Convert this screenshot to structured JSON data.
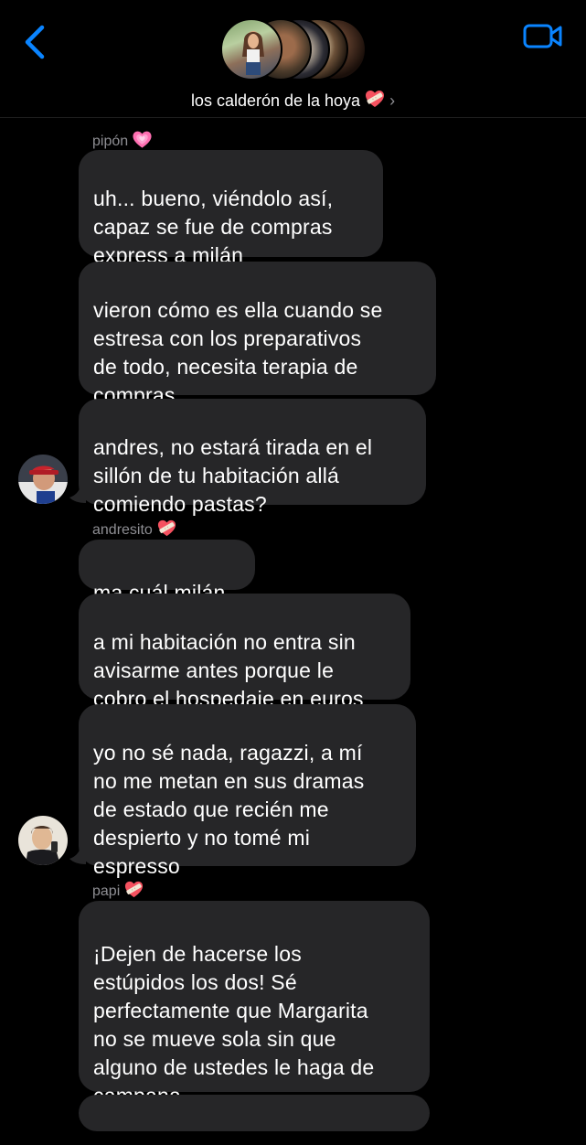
{
  "header": {
    "group_name": "los calderón de la hoya",
    "group_emoji": "heart-with-bandage",
    "back_icon": "chevron-left-icon",
    "video_icon": "video-camera-icon",
    "accent_color": "#0A84FF"
  },
  "colors": {
    "background": "#000000",
    "bubble": "#262628",
    "sender_name": "#8E8E93",
    "text": "#FFFFFF"
  },
  "messages": [
    {
      "sender": "pipón",
      "sender_emoji": "growing-heart",
      "bubbles": [
        "uh... bueno, viéndolo así,\ncapaz se fue de compras\nexpress a milán",
        "vieron cómo es ella cuando se\nestresa con los preparativos\nde todo, necesita terapia de\ncompras",
        "andres, no estará tirada en el\nsillón de tu habitación allá\ncomiendo pastas?"
      ]
    },
    {
      "sender": "andresito",
      "sender_emoji": "heart-with-bandage",
      "bubbles": [
        "ma cuál milán",
        "a mi habitación no entra sin\navisarme antes porque le\ncobro el hospedaje en euros",
        "yo no sé nada, ragazzi, a mí\nno me metan en sus dramas\nde estado que recién me\ndespierto y no tomé mi\nespresso"
      ]
    },
    {
      "sender": "papi",
      "sender_emoji": "heart-with-bandage",
      "bubbles": [
        "¡Dejen de hacerse los\nestúpidos los dos! Sé\nperfectamente que Margarita\nno se mueve sola sin que\nalguno de ustedes le haga de\ncampana"
      ]
    }
  ]
}
